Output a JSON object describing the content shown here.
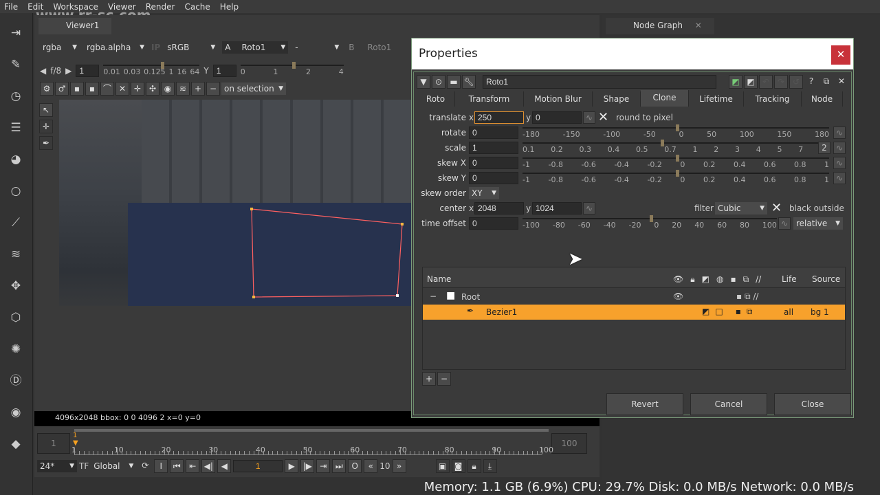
{
  "menu": [
    "File",
    "Edit",
    "Workspace",
    "Viewer",
    "Render",
    "Cache",
    "Help"
  ],
  "viewer": {
    "tab": "Viewer1",
    "channels": "rgba",
    "alpha": "rgba.alpha",
    "ip": "IP",
    "colorspace": "sRGB",
    "input_a_label": "A",
    "input_a": "Roto1",
    "wipe": "-",
    "input_b_label": "B",
    "input_b": "Roto1",
    "fstop": "f/8",
    "gain": "1",
    "gain_ticks": [
      "0.01",
      "0.03",
      "0.125",
      "1",
      "16",
      "64"
    ],
    "gamma_label": "Y",
    "gamma": "1",
    "gamma_ticks": [
      "0",
      "1",
      "2",
      "4"
    ],
    "roto_mode": "on selection",
    "info": "4096x2048  bbox: 0 0 4096 2  x=0 y=0"
  },
  "timeline": {
    "start": "1",
    "end": "100",
    "current": "1",
    "ticks": [
      "1",
      "10",
      "20",
      "30",
      "40",
      "50",
      "60",
      "70",
      "80",
      "90",
      "100"
    ],
    "fps": "24*",
    "tf": "TF",
    "global": "Global",
    "frame": "1",
    "step": "10"
  },
  "status": "Memory: 1.1 GB (6.9%) CPU: 29.7% Disk: 0.0 MB/s Network: 0.0 MB/s",
  "node_graph": {
    "tab": "Node Graph"
  },
  "watermark": "www.rr-sc.com",
  "properties": {
    "title": "Properties",
    "node_name": "Roto1",
    "tabs": [
      "Roto",
      "Transform",
      "Motion Blur",
      "Shape",
      "Clone",
      "Lifetime",
      "Tracking",
      "Node"
    ],
    "active_tab": "Clone",
    "translate": {
      "label": "translate",
      "x": "250",
      "y": "0",
      "round_label": "round to pixel"
    },
    "rotate": {
      "label": "rotate",
      "value": "0",
      "ticks": [
        "-180",
        "-150",
        "-100",
        "-50",
        "0",
        "50",
        "100",
        "150",
        "180"
      ]
    },
    "scale": {
      "label": "scale",
      "value": "1",
      "ticks": [
        "0.1",
        "0.2",
        "0.3",
        "0.4",
        "0.5",
        "0.7",
        "1",
        "2",
        "3",
        "4",
        "5",
        "7",
        "10"
      ],
      "dim_btn": "2"
    },
    "skewx": {
      "label": "skew X",
      "value": "0",
      "ticks": [
        "-1",
        "-0.8",
        "-0.6",
        "-0.4",
        "-0.2",
        "0",
        "0.2",
        "0.4",
        "0.6",
        "0.8",
        "1"
      ]
    },
    "skewy": {
      "label": "skew Y",
      "value": "0",
      "ticks": [
        "-1",
        "-0.8",
        "-0.6",
        "-0.4",
        "-0.2",
        "0",
        "0.2",
        "0.4",
        "0.6",
        "0.8",
        "1"
      ]
    },
    "skew_order": {
      "label": "skew order",
      "value": "XY"
    },
    "center": {
      "label": "center",
      "x": "2048",
      "y": "1024"
    },
    "filter": {
      "label": "filter",
      "value": "Cubic",
      "black_outside": "black outside"
    },
    "time_offset": {
      "label": "time offset",
      "value": "0",
      "ticks": [
        "-100",
        "-80",
        "-60",
        "-40",
        "-20",
        "0",
        "20",
        "40",
        "60",
        "80",
        "100"
      ],
      "mode": "relative"
    },
    "tree": {
      "columns": [
        "Name",
        "Life",
        "Source"
      ],
      "rows": [
        {
          "name": "Root"
        },
        {
          "name": "Bezier1",
          "life": "all",
          "source": "bg 1"
        }
      ]
    },
    "buttons": {
      "revert": "Revert",
      "cancel": "Cancel",
      "close": "Close",
      "add": "+",
      "remove": "−"
    }
  },
  "colors": {
    "accent": "#f7a12c",
    "close": "#c8323a"
  }
}
